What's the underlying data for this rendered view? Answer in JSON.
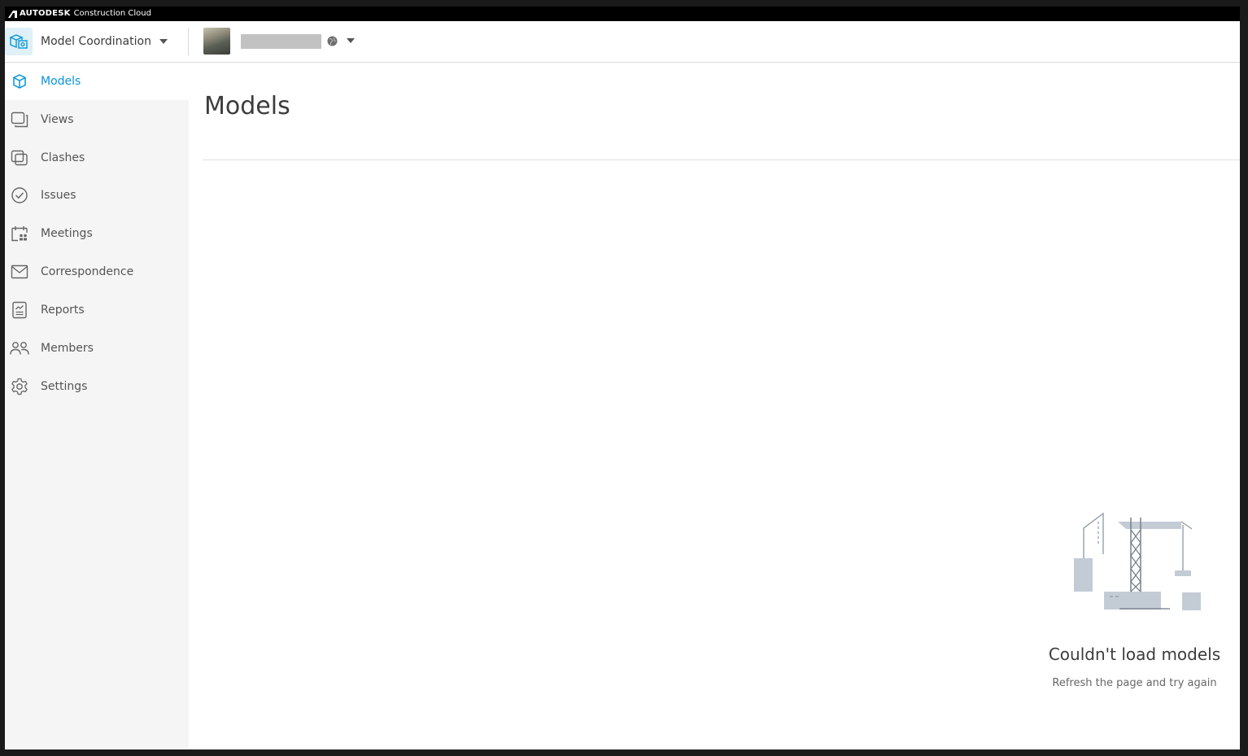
{
  "window": {
    "brand": "AUTODESK",
    "product": "Construction Cloud"
  },
  "header": {
    "module_label": "Model Coordination",
    "module_icon": "model-coordination-icon",
    "project_thumbnail": "project-thumbnail-image",
    "project_name_redacted": true
  },
  "sidebar": {
    "items": [
      {
        "label": "Models",
        "icon": "cube-icon",
        "active": true
      },
      {
        "label": "Views",
        "icon": "views-icon",
        "active": false
      },
      {
        "label": "Clashes",
        "icon": "clashes-icon",
        "active": false
      },
      {
        "label": "Issues",
        "icon": "check-circle-icon",
        "active": false
      },
      {
        "label": "Meetings",
        "icon": "calendar-icon",
        "active": false
      },
      {
        "label": "Correspondence",
        "icon": "envelope-icon",
        "active": false
      },
      {
        "label": "Reports",
        "icon": "report-icon",
        "active": false
      },
      {
        "label": "Members",
        "icon": "people-icon",
        "active": false
      },
      {
        "label": "Settings",
        "icon": "gear-icon",
        "active": false
      }
    ]
  },
  "main": {
    "title": "Models",
    "empty_state": {
      "title": "Couldn't load models",
      "subtitle": "Refresh the page and try again",
      "illustration": "construction-crane-illustration"
    }
  },
  "colors": {
    "accent": "#0696d7",
    "sidebar_bg": "#f5f5f5",
    "active_item_bg": "#ffffff",
    "text": "#3c3c3c"
  }
}
